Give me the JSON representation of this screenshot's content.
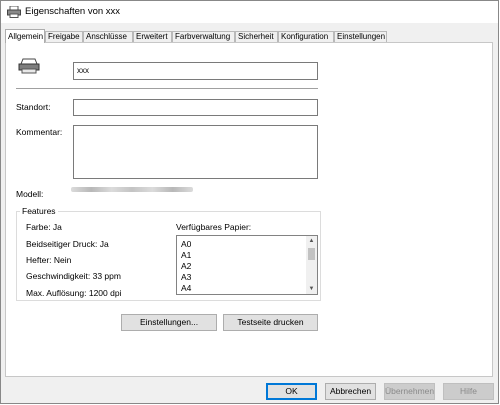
{
  "window": {
    "title": "Eigenschaften von xxx"
  },
  "tabs": [
    {
      "label": "Allgemein"
    },
    {
      "label": "Freigabe"
    },
    {
      "label": "Anschlüsse"
    },
    {
      "label": "Erweitert"
    },
    {
      "label": "Farbverwaltung"
    },
    {
      "label": "Sicherheit"
    },
    {
      "label": "Konfiguration"
    },
    {
      "label": "Einstellungen"
    }
  ],
  "general": {
    "printer_name": "xxx",
    "location_label": "Standort:",
    "location_value": "",
    "comment_label": "Kommentar:",
    "comment_value": "",
    "model_label": "Modell:"
  },
  "features": {
    "group_label": "Features",
    "color": "Farbe: Ja",
    "duplex": "Beidseitiger Druck: Ja",
    "stapler": "Hefter: Nein",
    "speed": "Geschwindigkeit: 33 ppm",
    "max_resolution": "Max. Auflösung: 1200 dpi",
    "paper_label": "Verfügbares Papier:",
    "paper_sizes": [
      "A0",
      "A1",
      "A2",
      "A3",
      "A4"
    ]
  },
  "buttons": {
    "preferences": "Einstellungen...",
    "test_page": "Testseite drucken",
    "ok": "OK",
    "cancel": "Abbrechen",
    "apply": "Übernehmen",
    "help": "Hilfe"
  }
}
